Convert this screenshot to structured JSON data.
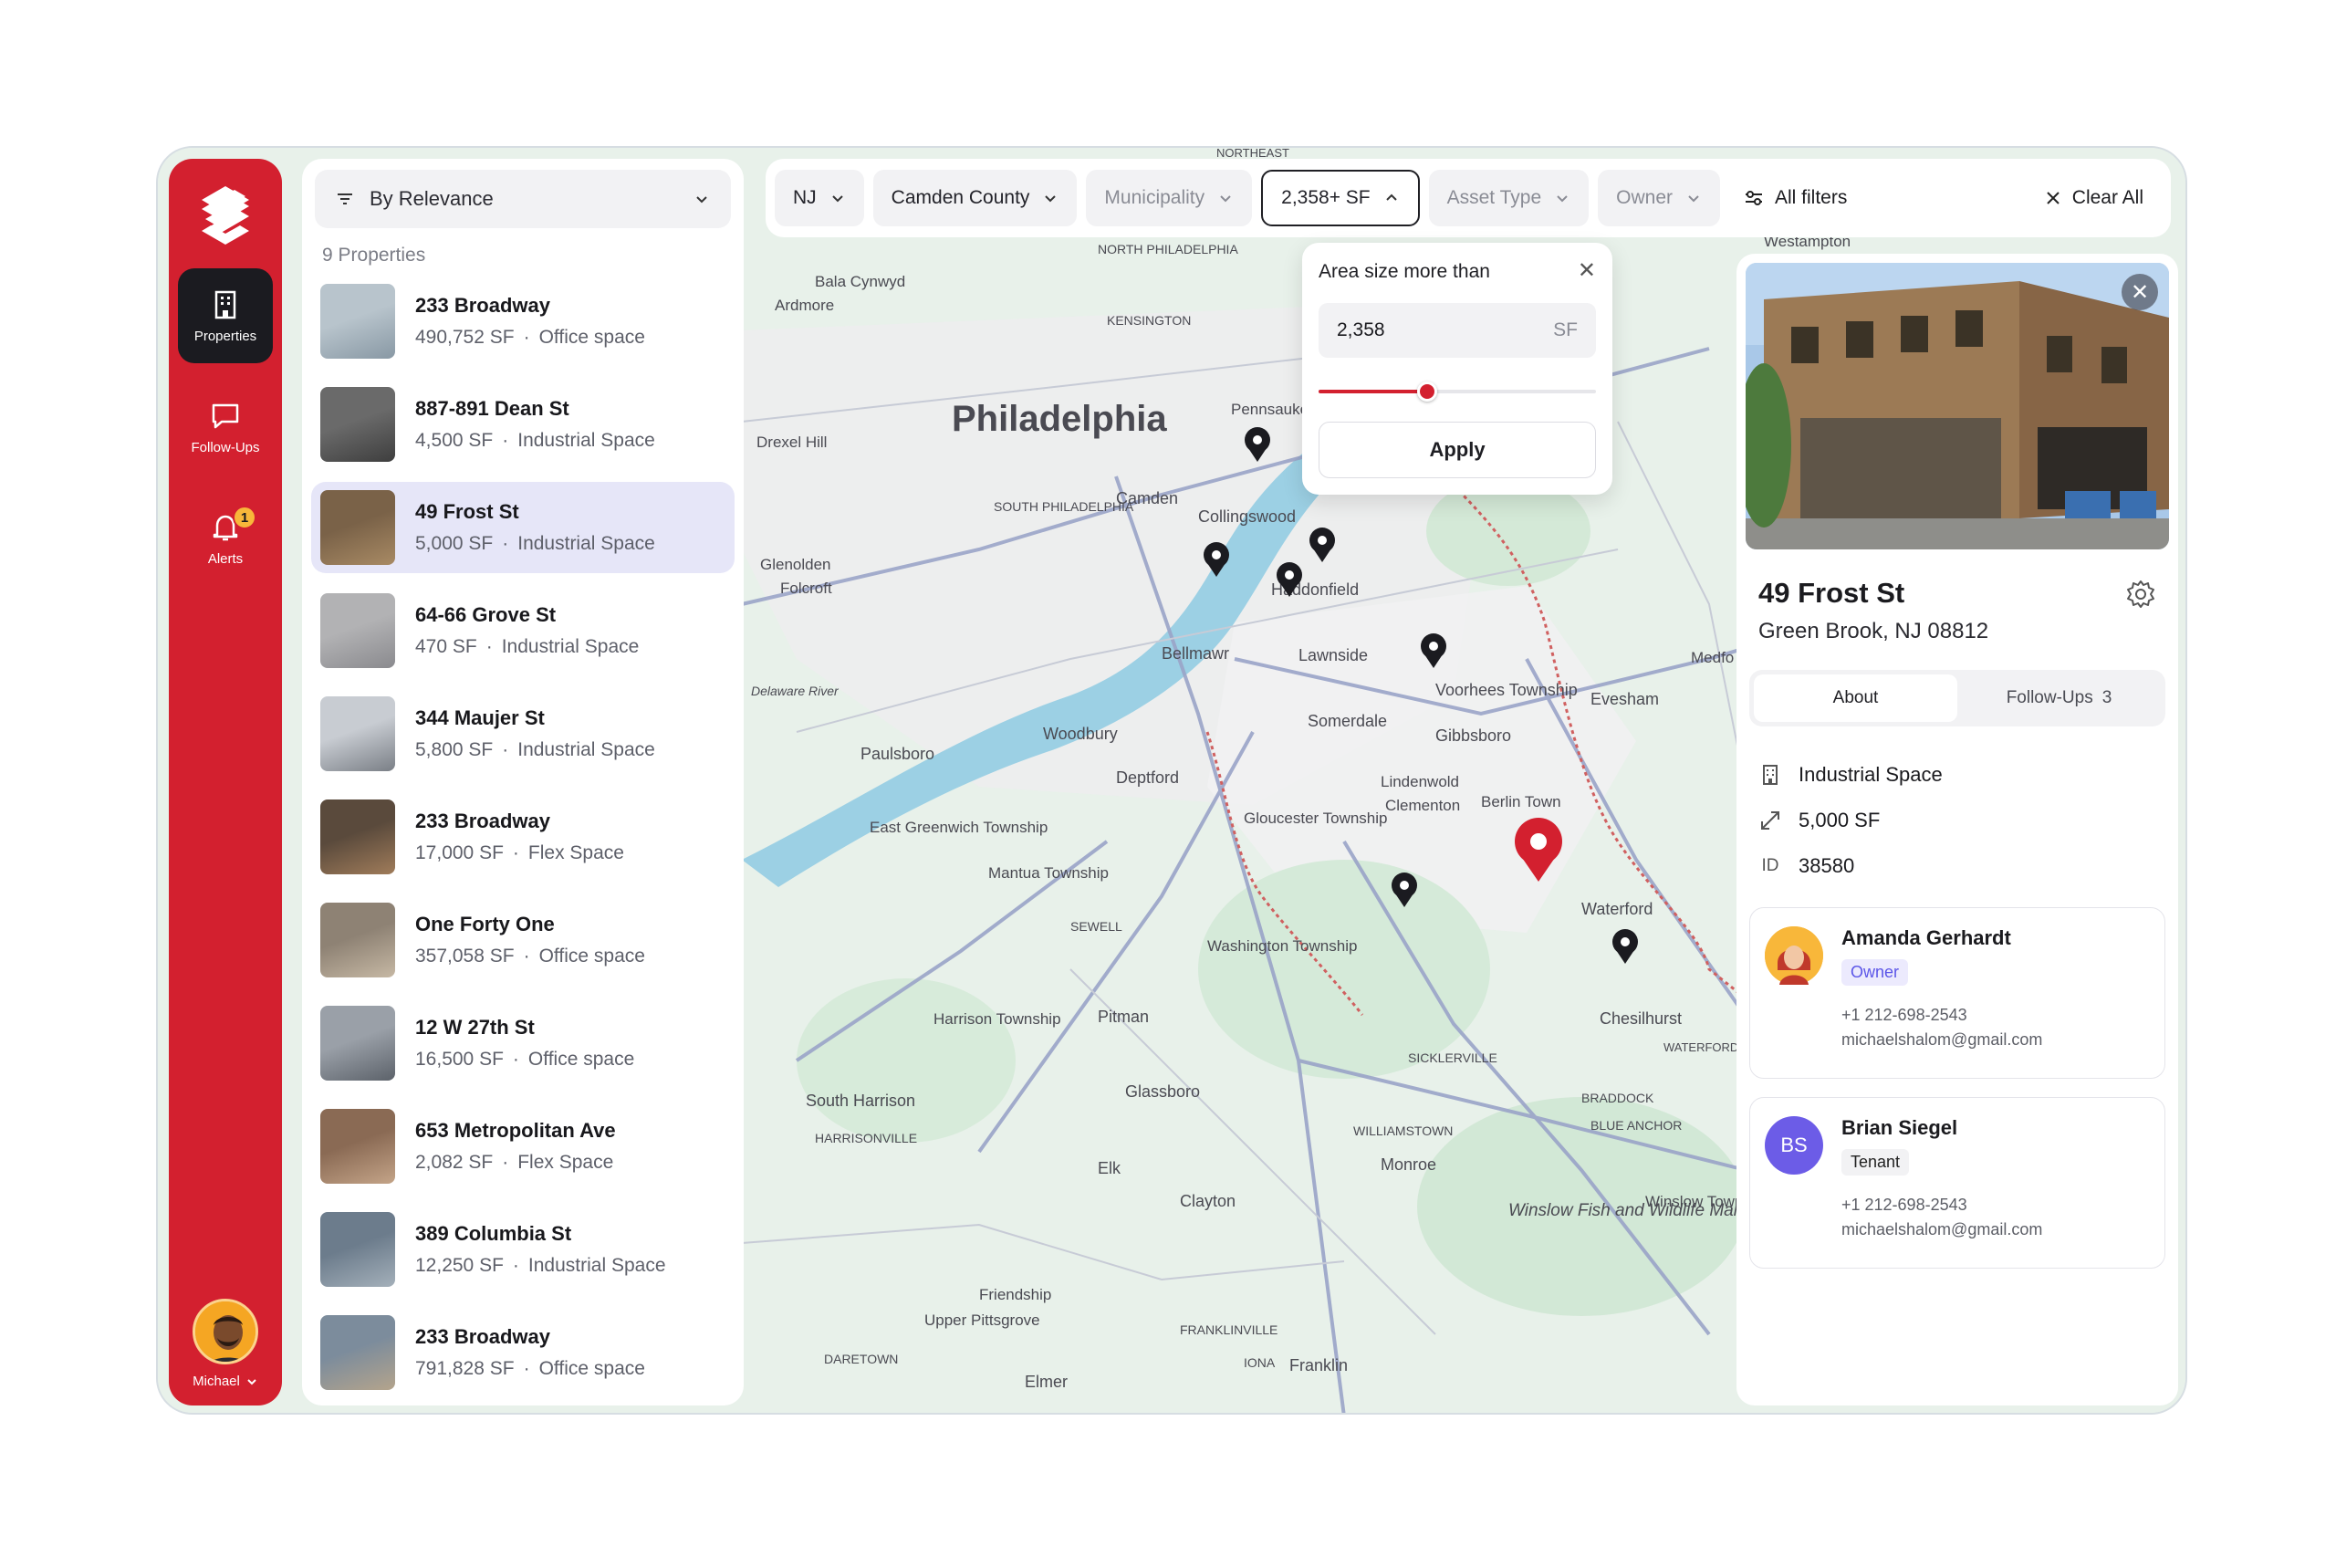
{
  "sidebar": {
    "nav": [
      {
        "label": "Properties",
        "icon": "building-icon",
        "active": true
      },
      {
        "label": "Follow-Ups",
        "icon": "chat-icon",
        "active": false
      },
      {
        "label": "Alerts",
        "icon": "bell-icon",
        "active": false,
        "badge": "1"
      }
    ],
    "user": {
      "name": "Michael"
    }
  },
  "list": {
    "sort_label": "By Relevance",
    "count_label": "9 Properties",
    "items": [
      {
        "name": "233 Broadway",
        "size": "490,752 SF",
        "type": "Office space"
      },
      {
        "name": "887-891 Dean St",
        "size": "4,500 SF",
        "type": "Industrial Space"
      },
      {
        "name": "49 Frost St",
        "size": "5,000 SF",
        "type": "Industrial Space"
      },
      {
        "name": "64-66 Grove St",
        "size": "470 SF",
        "type": "Industrial Space"
      },
      {
        "name": "344 Maujer St",
        "size": "5,800 SF",
        "type": "Industrial Space"
      },
      {
        "name": "233 Broadway",
        "size": "17,000 SF",
        "type": "Flex Space"
      },
      {
        "name": "One Forty One",
        "size": "357,058 SF",
        "type": "Office space"
      },
      {
        "name": "12 W 27th St",
        "size": "16,500 SF",
        "type": "Office space"
      },
      {
        "name": "653 Metropolitan Ave",
        "size": "2,082 SF",
        "type": "Flex Space"
      },
      {
        "name": "389 Columbia St",
        "size": "12,250 SF",
        "type": "Industrial Space"
      },
      {
        "name": "233 Broadway",
        "size": "791,828 SF",
        "type": "Office space"
      }
    ],
    "separator": "·"
  },
  "filters": {
    "state": "NJ",
    "county": "Camden County",
    "municipality": "Municipality",
    "area": "2,358+ SF",
    "asset_type": "Asset Type",
    "owner": "Owner",
    "all_filters": "All filters",
    "clear_all": "Clear All"
  },
  "area_popover": {
    "title": "Area size more than",
    "value": "2,358",
    "unit": "SF",
    "slider_fraction": 0.39,
    "apply": "Apply"
  },
  "detail": {
    "name": "49 Frost St",
    "address": "Green Brook, NJ 08812",
    "tabs": {
      "about": "About",
      "followups": "Follow-Ups",
      "followups_count": "3"
    },
    "facts": {
      "type": "Industrial Space",
      "size": "5,000 SF",
      "id_label": "ID",
      "id": "38580"
    },
    "contacts": [
      {
        "name": "Amanda Gerhardt",
        "role": "Owner",
        "phone": "+1 212-698-2543",
        "email": "michaelshalom@gmail.com"
      },
      {
        "initials": "BS",
        "name": "Brian Siegel",
        "role": "Tenant",
        "phone": "+1 212-698-2543",
        "email": "michaelshalom@gmail.com"
      }
    ]
  },
  "map": {
    "labels": {
      "philadelphia": "Philadelphia",
      "north_philadelphia": "NORTH PHILADELPHIA",
      "kensington": "KENSINGTON",
      "south_philadelphia": "SOUTH PHILADELPHIA",
      "camden": "Camden",
      "collingswood": "Collingswood",
      "haddonfield": "Haddonfield",
      "bellmawr": "Bellmawr",
      "lawnside": "Lawnside",
      "voorhees": "Voorhees Township",
      "gibbsboro": "Gibbsboro",
      "evesham": "Evesham",
      "somerdale": "Somerdale",
      "woodbury": "Woodbury",
      "deptford": "Deptford",
      "paulsboro": "Paulsboro",
      "east_greenwich": "East Greenwich Township",
      "mantua": "Mantua Township",
      "sewell": "SEWELL",
      "gloucester": "Gloucester Township",
      "lindenwold": "Lindenwold",
      "clementon": "Clementon",
      "berlin": "Berlin Town",
      "waterford": "Waterford",
      "washington": "Washington Township",
      "harrison": "Harrison Township",
      "pitman": "Pitman",
      "glassboro": "Glassboro",
      "sicklerville": "SICKLERVILLE",
      "chesilhurst": "Chesilhurst",
      "waterford_works": "WATERFORD WORKS",
      "braddock": "BRADDOCK",
      "blue_anchor": "BLUE ANCHOR",
      "williamstown": "WILLIAMSTOWN",
      "monroe": "Monroe",
      "south_harrison": "South Harrison",
      "harrisonville": "HARRISONVILLE",
      "elk": "Elk",
      "clayton": "Clayton",
      "winslow": "Winslow Township",
      "winslow_fish": "Winslow Fish and Wildlife Management Area",
      "upper_pittsgrove": "Upper Pittsgrove",
      "friendship": "Friendship",
      "franklinville": "FRANKLINVILLE",
      "daretown": "DARETOWN",
      "iona": "IONA",
      "franklin": "Franklin",
      "elmer": "Elmer",
      "bala_cynwyd": "Bala Cynwyd",
      "ardmore": "Ardmore",
      "drexel_hill": "Drexel Hill",
      "glenolden": "Glenolden",
      "folcroft": "Folcroft",
      "westampton": "Westampton",
      "pennsauken": "Pennsauken Township",
      "medford": "Medfo",
      "northeast": "NORTHEAST",
      "delaware_river": "Delaware River"
    }
  },
  "colors": {
    "brand": "#d3202f",
    "accent": "#5b55e8",
    "badge": "#f8b73a"
  }
}
